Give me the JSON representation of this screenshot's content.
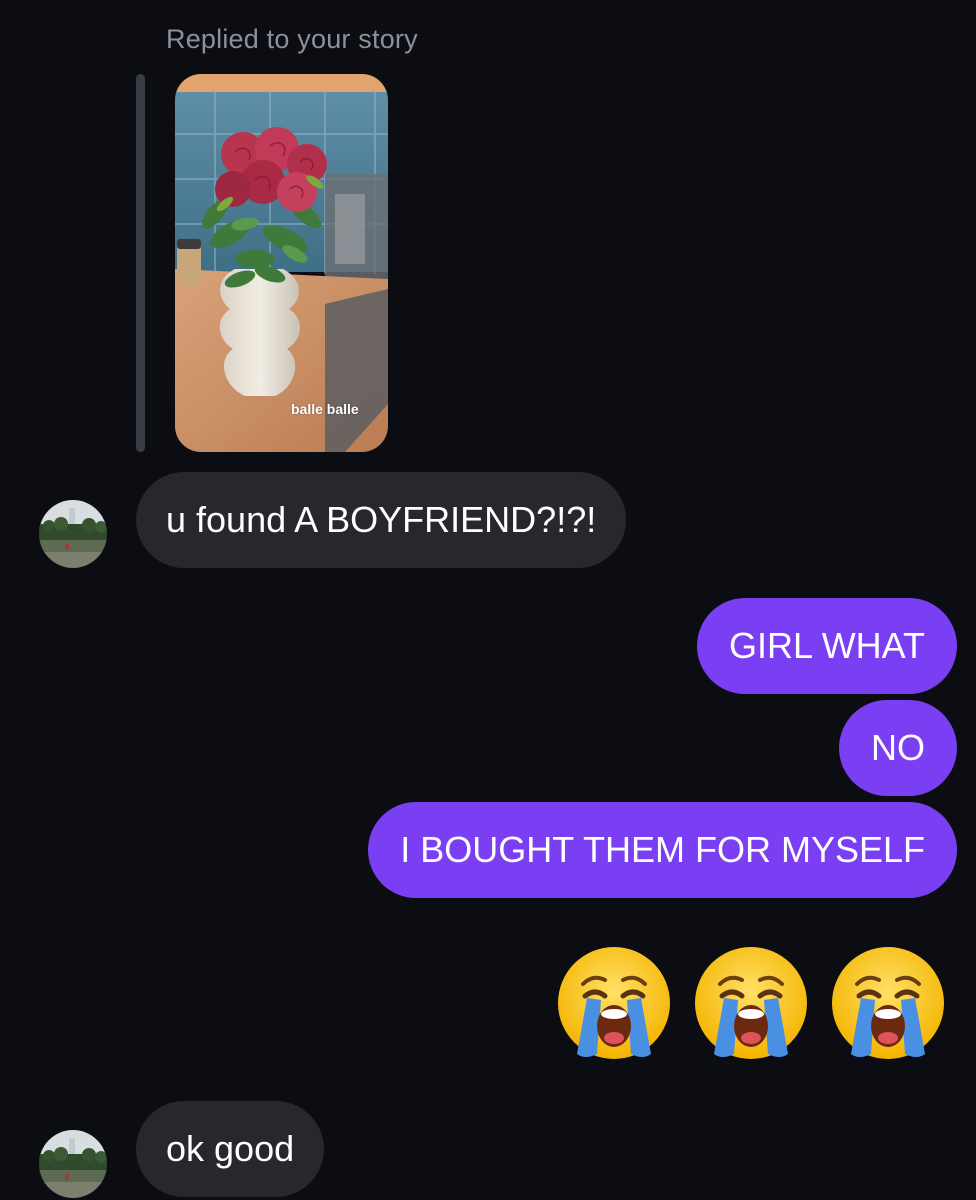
{
  "story_reply": {
    "label": "Replied to your story",
    "caption": "balle balle"
  },
  "messages": {
    "incoming_1": "u found A BOYFRIEND?!?!",
    "outgoing_1": "GIRL WHAT",
    "outgoing_2": "NO",
    "outgoing_3": "I BOUGHT THEM FOR MYSELF",
    "incoming_2": "ok good"
  },
  "emoji_reply": {
    "icon": "loudly-crying-face-icon",
    "count": 3
  },
  "colors": {
    "background": "#0b0d12",
    "incoming_bubble": "#26282e",
    "outgoing_bubble": "#7a3ff2",
    "muted_text": "#8e9099"
  }
}
